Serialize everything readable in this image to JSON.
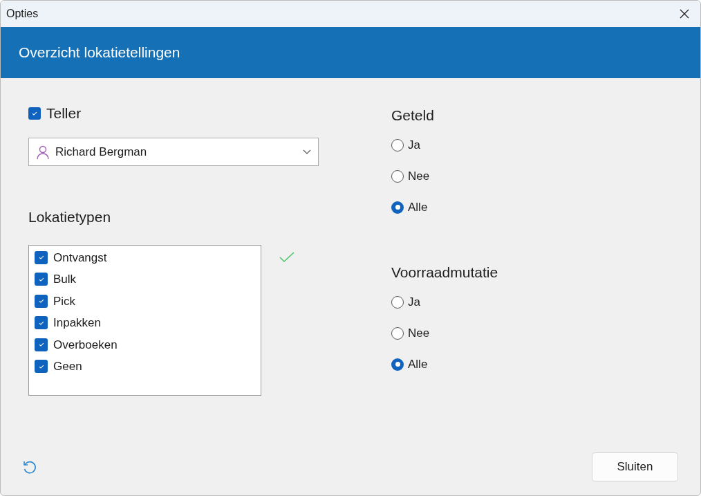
{
  "window": {
    "title": "Opties"
  },
  "header": {
    "title": "Overzicht lokatietellingen"
  },
  "teller": {
    "label": "Teller",
    "checked": true,
    "value": "Richard Bergman"
  },
  "lokatietypen": {
    "title": "Lokatietypen",
    "items": [
      {
        "label": "Ontvangst",
        "checked": true
      },
      {
        "label": "Bulk",
        "checked": true
      },
      {
        "label": "Pick",
        "checked": true
      },
      {
        "label": "Inpakken",
        "checked": true
      },
      {
        "label": "Overboeken",
        "checked": true
      },
      {
        "label": "Geen",
        "checked": true
      }
    ]
  },
  "radio_groups": [
    {
      "title": "Geteld",
      "options": [
        {
          "label": "Ja",
          "selected": false
        },
        {
          "label": "Nee",
          "selected": false
        },
        {
          "label": "Alle",
          "selected": true
        }
      ]
    },
    {
      "title": "Voorraadmutatie",
      "options": [
        {
          "label": "Ja",
          "selected": false
        },
        {
          "label": "Nee",
          "selected": false
        },
        {
          "label": "Alle",
          "selected": true
        }
      ]
    }
  ],
  "buttons": [
    {
      "label": "Sluiten"
    }
  ]
}
